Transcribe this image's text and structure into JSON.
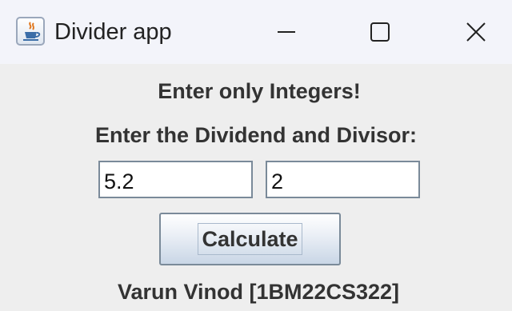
{
  "window": {
    "title": "Divider app",
    "controls": {
      "minimize_icon": "minimize-icon",
      "maximize_icon": "maximize-icon",
      "close_icon": "close-icon"
    },
    "app_icon": "java-cup-icon"
  },
  "form": {
    "warning_text": "Enter only Integers!",
    "prompt_text": "Enter the Dividend and Divisor:",
    "dividend_value": "5.2",
    "divisor_value": "2",
    "calculate_label": "Calculate",
    "author_text": "Varun Vinod [1BM22CS322]"
  },
  "colors": {
    "background": "#eeeeee",
    "titlebar": "#f3f4fa",
    "text": "#333333",
    "field_border": "#7a8a99"
  }
}
